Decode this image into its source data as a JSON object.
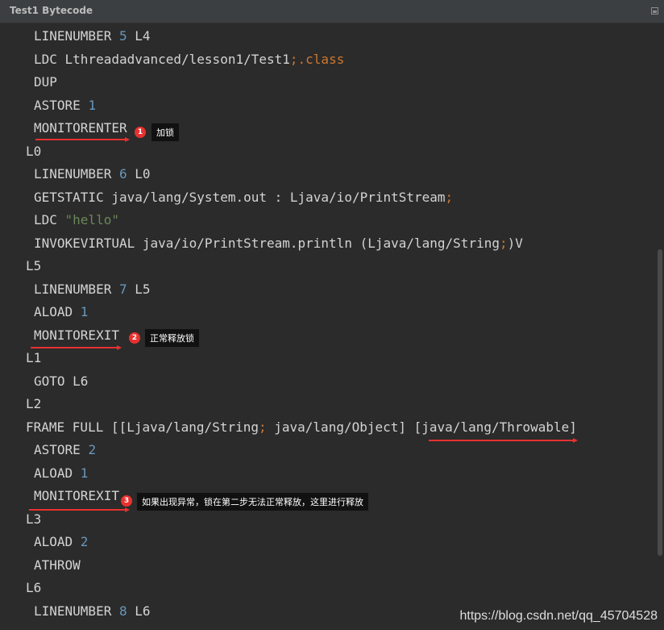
{
  "window": {
    "title": "Test1 Bytecode"
  },
  "code": {
    "l01": {
      "op": "LINENUMBER ",
      "n": "5",
      "rest": " L4"
    },
    "l02": {
      "text": "LDC Lthreadadvanced/lesson1/Test1",
      "sep": ";",
      "kw": ".class"
    },
    "l03": {
      "text": "DUP"
    },
    "l04": {
      "op": "ASTORE ",
      "n": "1"
    },
    "l05": {
      "text": "MONITORENTER"
    },
    "l06": {
      "text": "L0"
    },
    "l07": {
      "op": "LINENUMBER ",
      "n": "6",
      "rest": " L0"
    },
    "l08": {
      "text": "GETSTATIC java/lang/System.out : Ljava/io/PrintStream",
      "sep": ";"
    },
    "l09": {
      "op": "LDC ",
      "str": "\"hello\""
    },
    "l10": {
      "text": "INVOKEVIRTUAL java/io/PrintStream.println (Ljava/lang/String",
      "sep": ";",
      "rest": ")V"
    },
    "l11": {
      "text": "L5"
    },
    "l12": {
      "op": "LINENUMBER ",
      "n": "7",
      "rest": " L5"
    },
    "l13": {
      "op": "ALOAD ",
      "n": "1"
    },
    "l14": {
      "text": "MONITOREXIT"
    },
    "l15": {
      "text": "L1"
    },
    "l16": {
      "text": "GOTO L6"
    },
    "l17": {
      "text": "L2"
    },
    "l18": {
      "a": "FRAME FULL [[Ljava/lang/String",
      "sep": ";",
      "b": " java/lang/Object] [java/lang/Throwable]"
    },
    "l19": {
      "op": "ASTORE ",
      "n": "2"
    },
    "l20": {
      "op": "ALOAD ",
      "n": "1"
    },
    "l21": {
      "text": "MONITOREXIT"
    },
    "l22": {
      "text": "L3"
    },
    "l23": {
      "op": "ALOAD ",
      "n": "2"
    },
    "l24": {
      "text": "ATHROW"
    },
    "l25": {
      "text": "L6"
    },
    "l26": {
      "op": "LINENUMBER ",
      "n": "8",
      "rest": " L6"
    }
  },
  "annotations": {
    "a1": {
      "badge": "1",
      "note": "加锁"
    },
    "a2": {
      "badge": "2",
      "note": "正常释放锁"
    },
    "a3": {
      "badge": "3",
      "note": "如果出现异常，锁在第二步无法正常释放，这里进行释放"
    }
  },
  "watermark": "https://blog.csdn.net/qq_45704528",
  "colors": {
    "background": "#2b2b2b",
    "text": "#d3d3d3",
    "number": "#6897bb",
    "string": "#6a8759",
    "keyword": "#cc7832",
    "annotation_red": "#e8312f"
  }
}
